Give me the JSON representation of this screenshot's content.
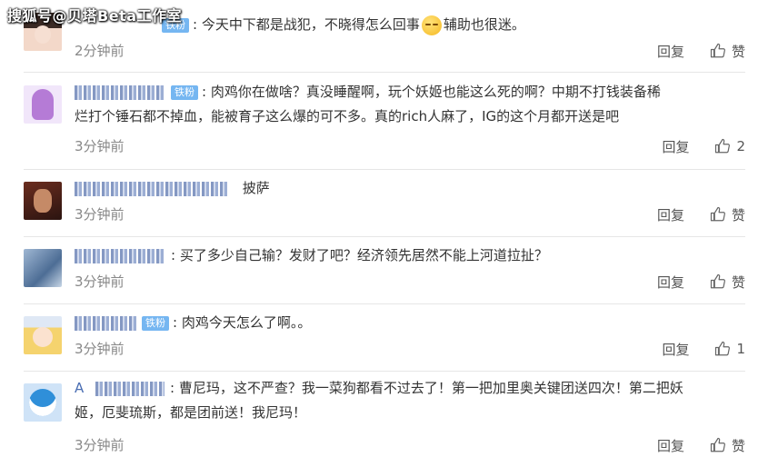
{
  "watermark": "搜狐号@贝塔Beta工作室",
  "labels": {
    "reply": "回复",
    "like": "赞"
  },
  "comments": [
    {
      "badge": "铁粉",
      "text_before": "今天中下都是战犯，不晓得怎么回事",
      "text_after": "辅助也很迷。",
      "time": "2分钟前",
      "likes": "",
      "emoji": "sleepy-face-emoji"
    },
    {
      "badge": "铁粉",
      "line1": "肉鸡你在做啥？真没睡醒啊，玩个妖姬也能这么死的啊？中期不打钱装备稀",
      "line2": "烂打个锤石都不掉血，能被育子这么爆的可不多。真的rich人麻了，IG的这个月都开送是吧",
      "time": "3分钟前",
      "likes": "2"
    },
    {
      "text": "披萨",
      "time": "3分钟前",
      "likes": ""
    },
    {
      "text": "买了多少自己输？发财了吧？经济领先居然不能上河道拉扯？",
      "time": "3分钟前",
      "likes": ""
    },
    {
      "badge": "铁粉",
      "text": "肉鸡今天怎么了啊。。",
      "time": "3分钟前",
      "likes": "1"
    },
    {
      "name_prefix": "A",
      "line1": "曹尼玛，这不严查？我一菜狗都看不过去了！第一把加里奥关键团送四次！第二把妖",
      "line2": "姬，厄斐琉斯，都是团前送！我尼玛！",
      "time": "3分钟前",
      "likes": ""
    }
  ],
  "icons": {
    "like": "thumbs-up-icon"
  }
}
